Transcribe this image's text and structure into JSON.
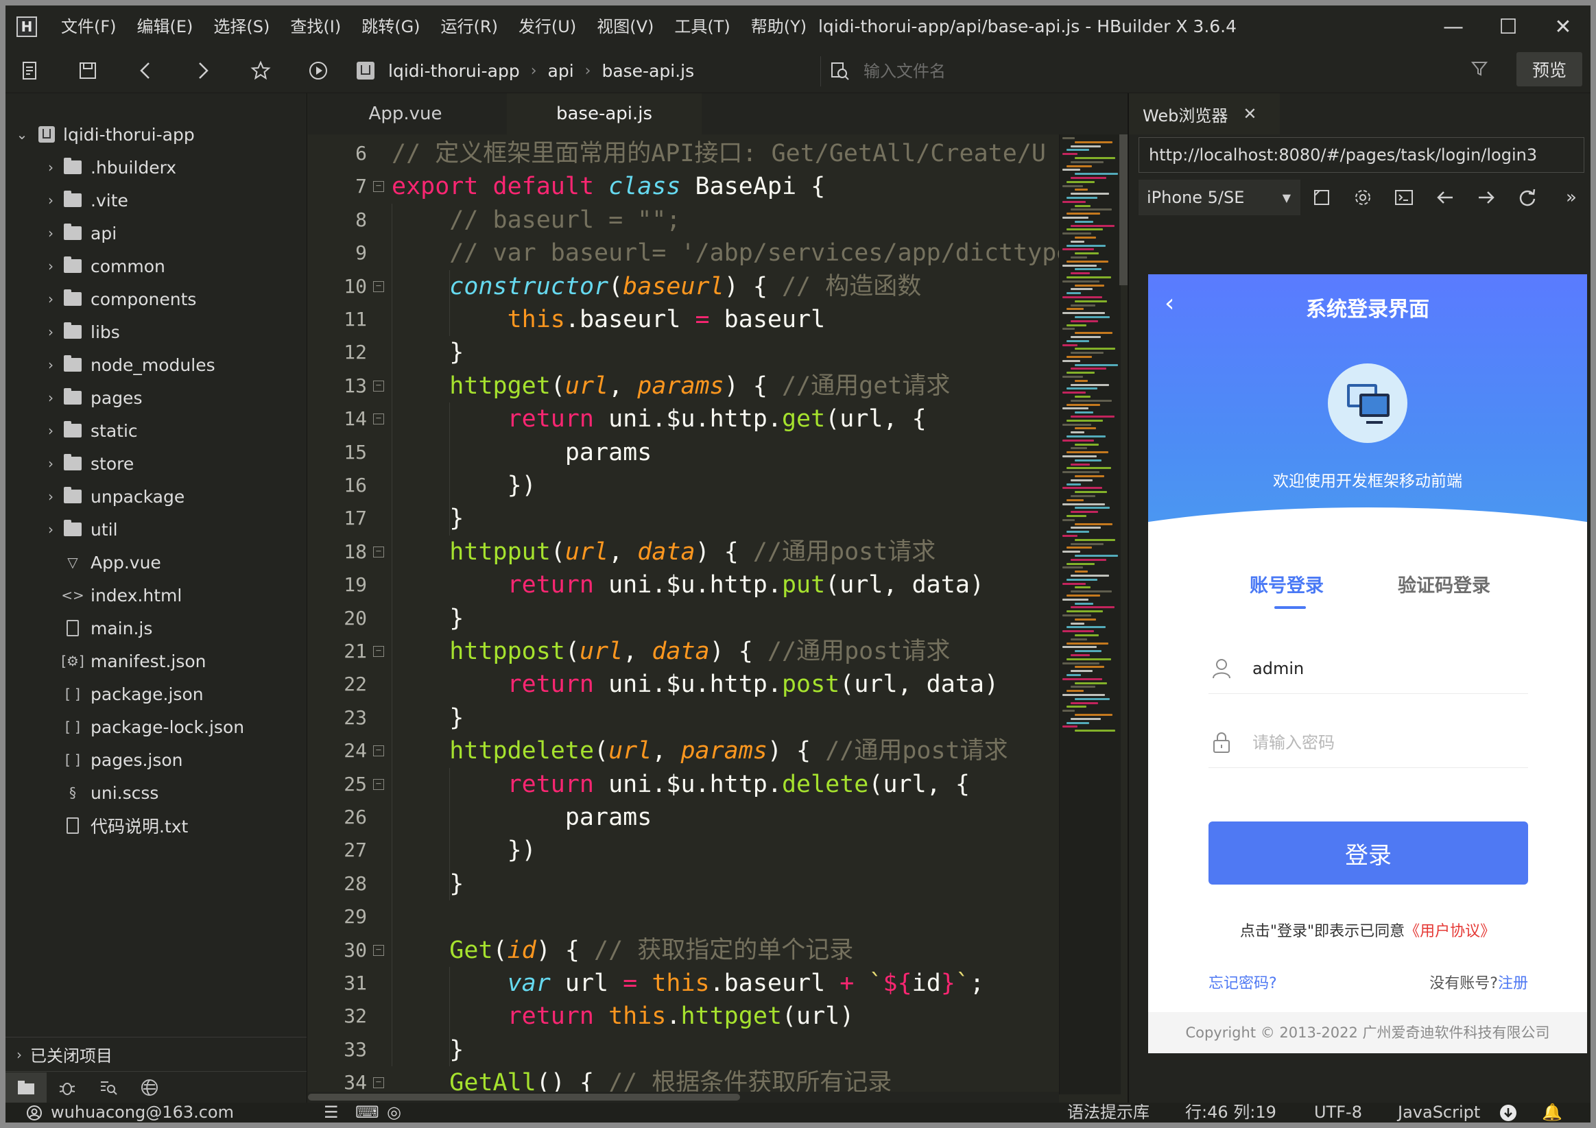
{
  "window": {
    "app_logo": "H",
    "title": "lqidi-thorui-app/api/base-api.js - HBuilder X 3.6.4",
    "menu": [
      "文件(F)",
      "编辑(E)",
      "选择(S)",
      "查找(I)",
      "跳转(G)",
      "运行(R)",
      "发行(U)",
      "视图(V)",
      "工具(T)",
      "帮助(Y)"
    ],
    "controls": {
      "minimize": "—",
      "maximize": "☐",
      "close": "✕"
    }
  },
  "toolbar": {
    "icons": [
      "new-file-icon",
      "save-icon",
      "back-icon",
      "forward-icon",
      "star-icon",
      "run-icon"
    ],
    "breadcrumb": [
      "lqidi-thorui-app",
      "api",
      "base-api.js"
    ],
    "search_placeholder": "输入文件名",
    "preview_label": "预览"
  },
  "sidebar": {
    "project": "lqidi-thorui-app",
    "items": [
      {
        "label": ".hbuilderx",
        "type": "folder"
      },
      {
        "label": ".vite",
        "type": "folder"
      },
      {
        "label": "api",
        "type": "folder"
      },
      {
        "label": "common",
        "type": "folder"
      },
      {
        "label": "components",
        "type": "folder"
      },
      {
        "label": "libs",
        "type": "folder"
      },
      {
        "label": "node_modules",
        "type": "folder"
      },
      {
        "label": "pages",
        "type": "folder"
      },
      {
        "label": "static",
        "type": "folder"
      },
      {
        "label": "store",
        "type": "folder"
      },
      {
        "label": "unpackage",
        "type": "folder"
      },
      {
        "label": "util",
        "type": "folder"
      },
      {
        "label": "App.vue",
        "type": "vue"
      },
      {
        "label": "index.html",
        "type": "html"
      },
      {
        "label": "main.js",
        "type": "js"
      },
      {
        "label": "manifest.json",
        "type": "manifest"
      },
      {
        "label": "package.json",
        "type": "json"
      },
      {
        "label": "package-lock.json",
        "type": "json"
      },
      {
        "label": "pages.json",
        "type": "json"
      },
      {
        "label": "uni.scss",
        "type": "scss"
      },
      {
        "label": "代码说明.txt",
        "type": "txt"
      }
    ],
    "closed_projects": "已关闭项目"
  },
  "editor": {
    "tabs": [
      {
        "label": "App.vue",
        "active": false
      },
      {
        "label": "base-api.js",
        "active": true
      }
    ],
    "lines": [
      {
        "n": "6",
        "fold": false,
        "tokens": [
          [
            "cm",
            "// 定义框架里面常用的API接口: Get/GetAll/Create/U"
          ]
        ]
      },
      {
        "n": "7",
        "fold": true,
        "tokens": [
          [
            "kw",
            "export"
          ],
          [
            "plain",
            " "
          ],
          [
            "kw",
            "default"
          ],
          [
            "plain",
            " "
          ],
          [
            "cls",
            "class"
          ],
          [
            "plain",
            " BaseApi {"
          ]
        ]
      },
      {
        "n": "8",
        "fold": false,
        "tokens": [
          [
            "plain",
            "    "
          ],
          [
            "cm",
            "// baseurl = \"\";"
          ]
        ]
      },
      {
        "n": "9",
        "fold": false,
        "tokens": [
          [
            "plain",
            "    "
          ],
          [
            "cm",
            "// var baseurl= '/abp/services/app/dicttype"
          ]
        ]
      },
      {
        "n": "10",
        "fold": true,
        "tokens": [
          [
            "plain",
            "    "
          ],
          [
            "cls",
            "constructor"
          ],
          [
            "plain",
            "("
          ],
          [
            "param",
            "baseurl"
          ],
          [
            "plain",
            ") { "
          ],
          [
            "cm",
            "// 构造函数"
          ]
        ]
      },
      {
        "n": "11",
        "fold": false,
        "tokens": [
          [
            "plain",
            "        "
          ],
          [
            "this",
            "this"
          ],
          [
            "plain",
            ".baseurl "
          ],
          [
            "kw",
            "="
          ],
          [
            "plain",
            " baseurl"
          ]
        ]
      },
      {
        "n": "12",
        "fold": false,
        "tokens": [
          [
            "plain",
            "    }"
          ]
        ]
      },
      {
        "n": "13",
        "fold": true,
        "tokens": [
          [
            "plain",
            "    "
          ],
          [
            "fn",
            "httpget"
          ],
          [
            "plain",
            "("
          ],
          [
            "param",
            "url"
          ],
          [
            "plain",
            ", "
          ],
          [
            "param",
            "params"
          ],
          [
            "plain",
            ") { "
          ],
          [
            "cm",
            "//通用get请求"
          ]
        ]
      },
      {
        "n": "14",
        "fold": true,
        "tokens": [
          [
            "plain",
            "        "
          ],
          [
            "kw",
            "return"
          ],
          [
            "plain",
            " uni.$u.http."
          ],
          [
            "fn",
            "get"
          ],
          [
            "plain",
            "(url, {"
          ]
        ]
      },
      {
        "n": "15",
        "fold": false,
        "tokens": [
          [
            "plain",
            "            params"
          ]
        ]
      },
      {
        "n": "16",
        "fold": false,
        "tokens": [
          [
            "plain",
            "        })"
          ]
        ]
      },
      {
        "n": "17",
        "fold": false,
        "tokens": [
          [
            "plain",
            "    }"
          ]
        ]
      },
      {
        "n": "18",
        "fold": true,
        "tokens": [
          [
            "plain",
            "    "
          ],
          [
            "fn",
            "httpput"
          ],
          [
            "plain",
            "("
          ],
          [
            "param",
            "url"
          ],
          [
            "plain",
            ", "
          ],
          [
            "param",
            "data"
          ],
          [
            "plain",
            ") { "
          ],
          [
            "cm",
            "//通用post请求"
          ]
        ]
      },
      {
        "n": "19",
        "fold": false,
        "tokens": [
          [
            "plain",
            "        "
          ],
          [
            "kw",
            "return"
          ],
          [
            "plain",
            " uni.$u.http."
          ],
          [
            "fn",
            "put"
          ],
          [
            "plain",
            "(url, data)"
          ]
        ]
      },
      {
        "n": "20",
        "fold": false,
        "tokens": [
          [
            "plain",
            "    }"
          ]
        ]
      },
      {
        "n": "21",
        "fold": true,
        "tokens": [
          [
            "plain",
            "    "
          ],
          [
            "fn",
            "httppost"
          ],
          [
            "plain",
            "("
          ],
          [
            "param",
            "url"
          ],
          [
            "plain",
            ", "
          ],
          [
            "param",
            "data"
          ],
          [
            "plain",
            ") { "
          ],
          [
            "cm",
            "//通用post请求"
          ]
        ]
      },
      {
        "n": "22",
        "fold": false,
        "tokens": [
          [
            "plain",
            "        "
          ],
          [
            "kw",
            "return"
          ],
          [
            "plain",
            " uni.$u.http."
          ],
          [
            "fn",
            "post"
          ],
          [
            "plain",
            "(url, data)"
          ]
        ]
      },
      {
        "n": "23",
        "fold": false,
        "tokens": [
          [
            "plain",
            "    }"
          ]
        ]
      },
      {
        "n": "24",
        "fold": true,
        "tokens": [
          [
            "plain",
            "    "
          ],
          [
            "fn",
            "httpdelete"
          ],
          [
            "plain",
            "("
          ],
          [
            "param",
            "url"
          ],
          [
            "plain",
            ", "
          ],
          [
            "param",
            "params"
          ],
          [
            "plain",
            ") { "
          ],
          [
            "cm",
            "//通用post请求"
          ]
        ]
      },
      {
        "n": "25",
        "fold": true,
        "tokens": [
          [
            "plain",
            "        "
          ],
          [
            "kw",
            "return"
          ],
          [
            "plain",
            " uni.$u.http."
          ],
          [
            "fn",
            "delete"
          ],
          [
            "plain",
            "(url, {"
          ]
        ]
      },
      {
        "n": "26",
        "fold": false,
        "tokens": [
          [
            "plain",
            "            params"
          ]
        ]
      },
      {
        "n": "27",
        "fold": false,
        "tokens": [
          [
            "plain",
            "        })"
          ]
        ]
      },
      {
        "n": "28",
        "fold": false,
        "tokens": [
          [
            "plain",
            "    }"
          ]
        ]
      },
      {
        "n": "29",
        "fold": false,
        "tokens": [
          [
            "plain",
            ""
          ]
        ]
      },
      {
        "n": "30",
        "fold": true,
        "tokens": [
          [
            "plain",
            "    "
          ],
          [
            "fn",
            "Get"
          ],
          [
            "plain",
            "("
          ],
          [
            "param",
            "id"
          ],
          [
            "plain",
            ") { "
          ],
          [
            "cm",
            "// 获取指定的单个记录"
          ]
        ]
      },
      {
        "n": "31",
        "fold": false,
        "tokens": [
          [
            "plain",
            "        "
          ],
          [
            "cls",
            "var"
          ],
          [
            "plain",
            " url "
          ],
          [
            "kw",
            "="
          ],
          [
            "plain",
            " "
          ],
          [
            "this",
            "this"
          ],
          [
            "plain",
            ".baseurl "
          ],
          [
            "kw",
            "+"
          ],
          [
            "plain",
            " "
          ],
          [
            "str",
            "`"
          ],
          [
            "kw",
            "${"
          ],
          [
            "plain",
            "id"
          ],
          [
            "kw",
            "}"
          ],
          [
            "str",
            "`"
          ],
          [
            "plain",
            ";"
          ]
        ]
      },
      {
        "n": "32",
        "fold": false,
        "tokens": [
          [
            "plain",
            "        "
          ],
          [
            "kw",
            "return"
          ],
          [
            "plain",
            " "
          ],
          [
            "this",
            "this"
          ],
          [
            "plain",
            "."
          ],
          [
            "fn",
            "httpget"
          ],
          [
            "plain",
            "(url)"
          ]
        ]
      },
      {
        "n": "33",
        "fold": false,
        "tokens": [
          [
            "plain",
            "    }"
          ]
        ]
      },
      {
        "n": "34",
        "fold": true,
        "tokens": [
          [
            "plain",
            "    "
          ],
          [
            "fn",
            "GetAll"
          ],
          [
            "plain",
            "() { "
          ],
          [
            "cm",
            "// 根据条件获取所有记录"
          ]
        ]
      }
    ]
  },
  "browser": {
    "tab_label": "Web浏览器",
    "tab_close": "✕",
    "url": "http://localhost:8080/#/pages/task/login/login3",
    "device": "iPhone 5/SE",
    "tools": [
      "rotate-icon",
      "settings-icon",
      "console-icon",
      "back-arrow-icon",
      "forward-arrow-icon",
      "refresh-icon",
      "more-icon"
    ],
    "page": {
      "back_glyph": "‹",
      "title": "系统登录界面",
      "welcome": "欢迎使用开发框架移动前端",
      "tabs": [
        "账号登录",
        "验证码登录"
      ],
      "username_value": "admin",
      "password_placeholder": "请输入密码",
      "login_button": "登录",
      "agreement_prefix": "点击\"登录\"即表示已同意",
      "agreement_link": "《用户协议》",
      "forgot": "忘记密码?",
      "no_account": "没有账号?",
      "register": "注册",
      "copyright": "Copyright © 2013-2022 广州爱奇迪软件科技有限公司"
    }
  },
  "statusbar": {
    "account": "wuhuacong@163.com",
    "syntax": "语法提示库",
    "position": "行:46  列:19",
    "encoding": "UTF-8",
    "language": "JavaScript"
  },
  "colors": {
    "accent": "#4f79f3",
    "keyword": "#f92672",
    "function": "#a6e22e",
    "class": "#66d9ef",
    "param": "#fd971f",
    "comment": "#75715e",
    "string": "#e6db74"
  }
}
